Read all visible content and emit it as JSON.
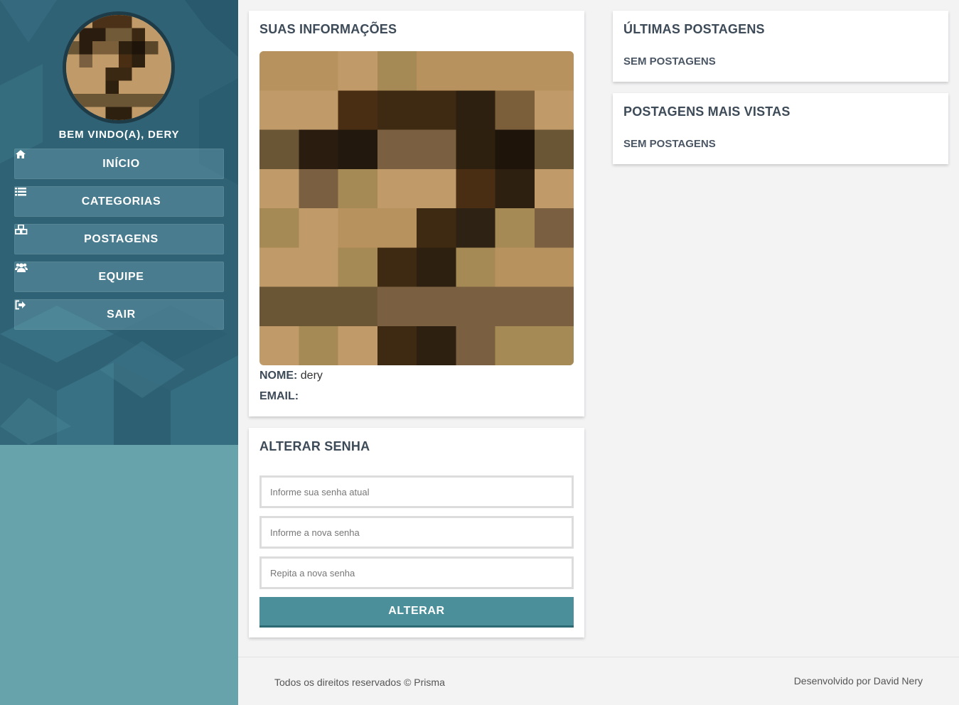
{
  "sidebar": {
    "welcome": "BEM VINDO(A), DERY",
    "items": [
      {
        "label": "INÍCIO",
        "icon": "home-icon"
      },
      {
        "label": "CATEGORIAS",
        "icon": "list-icon"
      },
      {
        "label": "POSTAGENS",
        "icon": "cubes-icon"
      },
      {
        "label": "EQUIPE",
        "icon": "users-icon"
      },
      {
        "label": "SAIR",
        "icon": "sign-out-icon"
      }
    ],
    "colors": {
      "top": "#2f6275",
      "bottom": "#67a3ab"
    }
  },
  "info": {
    "title": "SUAS INFORMAÇÕES",
    "name_label": "NOME:",
    "name_value": "dery",
    "email_label": "EMAIL:",
    "email_value": ""
  },
  "password": {
    "title": "ALTERAR SENHA",
    "current_placeholder": "Informe sua senha atual",
    "new_placeholder": "Informe a nova senha",
    "repeat_placeholder": "Repita a nova senha",
    "button": "ALTERAR",
    "button_color": "#4a8f99"
  },
  "latest": {
    "title": "ÚLTIMAS POSTAGENS",
    "empty": "SEM POSTAGENS"
  },
  "most_viewed": {
    "title": "POSTAGENS MAIS VISTAS",
    "empty": "SEM POSTAGENS"
  },
  "footer": {
    "left": "Todos os direitos reservados © Prisma",
    "right": "Desenvolvido por David Nery"
  }
}
